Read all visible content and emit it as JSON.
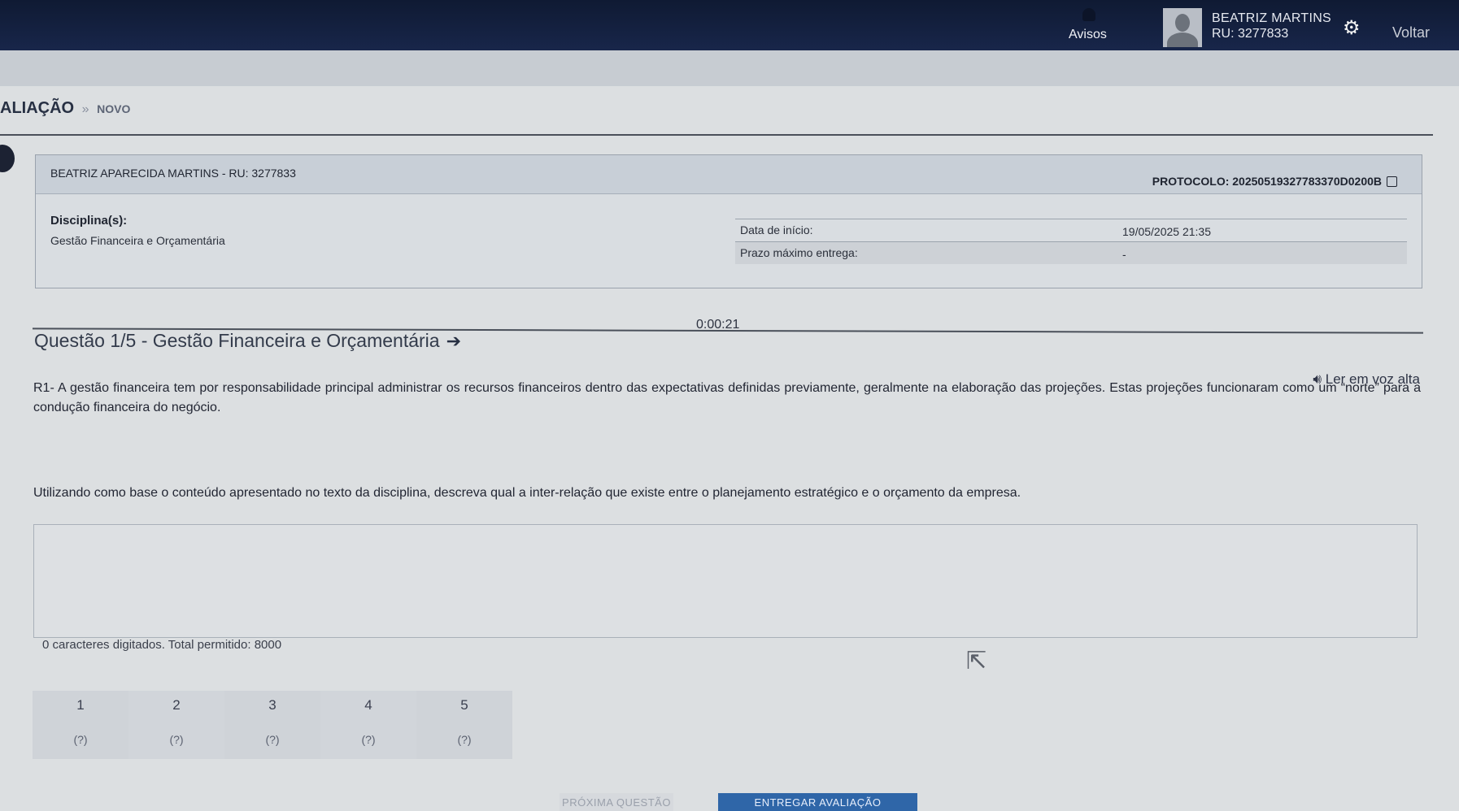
{
  "topbar": {
    "avisos": "Avisos",
    "user_name": "BEATRIZ MARTINS",
    "user_ru": "RU: 3277833",
    "voltar": "Voltar"
  },
  "breadcrumb": {
    "section": "ALIAÇÃO",
    "separator": "»",
    "current": "NOVO"
  },
  "info": {
    "student": "BEATRIZ APARECIDA MARTINS - RU: 3277833",
    "protocol": "PROTOCOLO: 20250519327783370D0200B",
    "disciplina_label": "Disciplina(s):",
    "disciplina_value": "Gestão Financeira e Orçamentária",
    "data_inicio_label": "Data de início:",
    "data_inicio_value": "19/05/2025 21:35",
    "prazo_label": "Prazo máximo entrega:",
    "prazo_value": "-"
  },
  "timer": "0:00:21",
  "question": {
    "title": "Questão 1/5 - Gestão Financeira e Orçamentária",
    "tts": "Ler em voz alta",
    "text1": "R1- A gestão financeira tem por responsabilidade principal administrar os recursos financeiros dentro das expectativas definidas previamente, geralmente na elaboração das projeções. Estas projeções funcionaram como um “norte” para a condução financeira do negócio.",
    "text2": "Utilizando como base o conteúdo apresentado no texto da disciplina, descreva qual a inter-relação que existe entre o planejamento estratégico e o orçamento da empresa.",
    "answer_value": "",
    "counter": "0 caracteres digitados. Total permitido: 8000"
  },
  "nav": [
    {
      "num": "1",
      "status": "(?)"
    },
    {
      "num": "2",
      "status": "(?)"
    },
    {
      "num": "3",
      "status": "(?)"
    },
    {
      "num": "4",
      "status": "(?)"
    },
    {
      "num": "5",
      "status": "(?)"
    }
  ],
  "buttons": {
    "next": "PRÓXIMA QUESTÃO",
    "submit": "ENTREGAR AVALIAÇÃO"
  },
  "icons": {
    "bell": "bell-icon",
    "gear": "gear-icon",
    "copy": "copy-icon",
    "arrow": "arrow-right-icon",
    "speaker": "speaker-icon",
    "cursor": "mouse-cursor-icon"
  },
  "colors": {
    "topbar": "#0f1a33",
    "submit": "#2f66a8"
  }
}
